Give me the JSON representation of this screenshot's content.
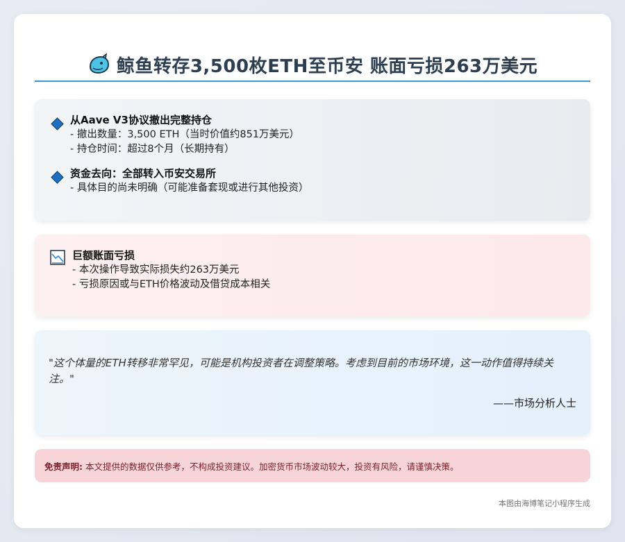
{
  "title": "鲸鱼转存3,500枚ETH至币安 账面亏损263万美元",
  "title_icon": "whale-icon",
  "section1": {
    "items": [
      {
        "heading": "从Aave V3协议撤出完整持仓",
        "lines": [
          "- 撤出数量：3,500 ETH（当时价值约851万美元）",
          "- 持仓时间：超过8个月（长期持有）"
        ]
      },
      {
        "heading": "资金去向：全部转入币安交易所",
        "lines": [
          "- 具体目的尚未明确（可能准备套现或进行其他投资）"
        ]
      }
    ]
  },
  "section2": {
    "icon": "chart-down-icon",
    "heading": "巨额账面亏损",
    "lines": [
      "- 本次操作导致实际损失约263万美元",
      "- 亏损原因或与ETH价格波动及借贷成本相关"
    ]
  },
  "quote": {
    "text": "\"这个体量的ETH转移非常罕见，可能是机构投资者在调整策略。考虑到目前的市场环境，这一动作值得持续关注。\"",
    "source": "——市场分析人士"
  },
  "disclaimer": {
    "label": "免责声明:",
    "text": " 本文提供的数据仅供参考，不构成投资建议。加密货币市场波动较大，投资有风险，请谨慎决策。"
  },
  "footer": "本图由海博笔记小程序生成",
  "colors": {
    "accent": "#3498db",
    "title": "#2c3e50",
    "diamond": "#1e6fc0",
    "disclaimer_bg": "#f6d4d7"
  }
}
